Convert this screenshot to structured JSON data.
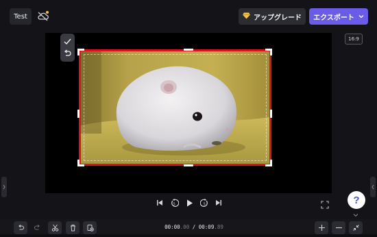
{
  "header": {
    "project_title": "Test",
    "upgrade_label": "アップグレード",
    "export_label": "エクスポート",
    "export_color": "#6b5ce7",
    "upgrade_icon": "diamond-icon",
    "cloud_icon": "cloud-off-icon"
  },
  "canvas": {
    "aspect_ratio": "16:9",
    "crop_border_color": "#e0101e",
    "crop_tools": [
      "check-icon",
      "undo-icon"
    ]
  },
  "player": {
    "controls": [
      "skip-back-icon",
      "rewind-5-icon",
      "play-icon",
      "forward-5-icon",
      "skip-forward-icon"
    ],
    "fullscreen_icon": "fullscreen-icon",
    "help_label": "?"
  },
  "timeline": {
    "current_main": "00:00",
    "current_frac": ".00",
    "separator": " / ",
    "total_main": "00:09",
    "total_frac": ".89",
    "left_tools": [
      "undo-icon",
      "redo-icon",
      "cut-icon",
      "delete-icon",
      "duplicate-icon"
    ],
    "right_tools": [
      "zoom-in-icon",
      "zoom-out-icon",
      "fit-icon"
    ]
  }
}
